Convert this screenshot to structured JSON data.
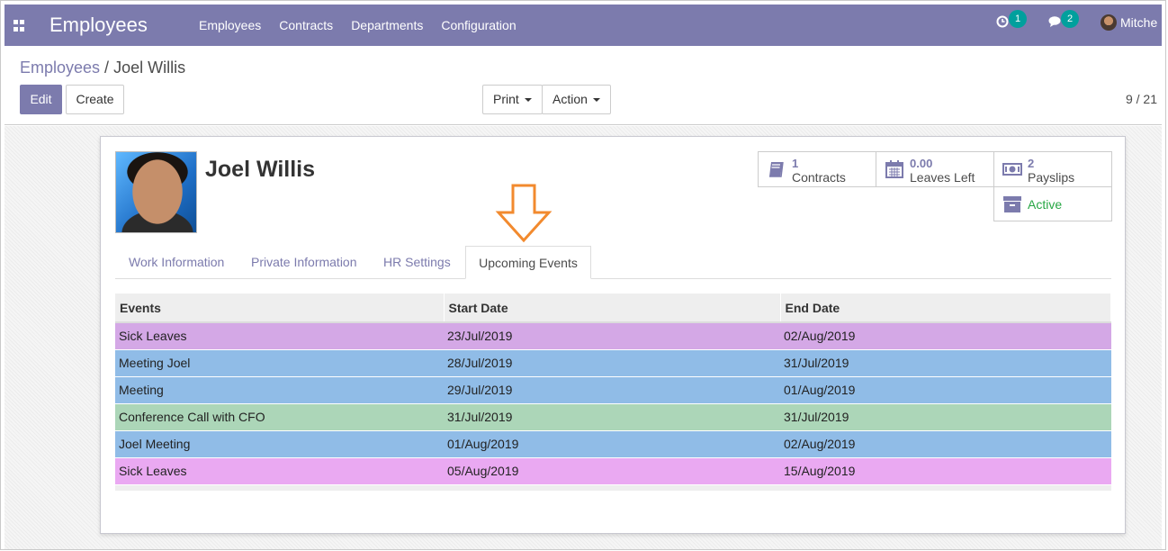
{
  "navbar": {
    "app_title": "Employees",
    "menu": [
      "Employees",
      "Contracts",
      "Departments",
      "Configuration"
    ],
    "activity_count": "1",
    "messages_count": "2",
    "user_name": "Mitche"
  },
  "breadcrumb": {
    "parent": "Employees",
    "separator": "/",
    "current": "Joel Willis"
  },
  "toolbar": {
    "edit_label": "Edit",
    "create_label": "Create",
    "print_label": "Print",
    "action_label": "Action",
    "pager": "9 / 21"
  },
  "employee": {
    "name": "Joel Willis"
  },
  "stats": {
    "contracts": {
      "value": "1",
      "label": "Contracts"
    },
    "leaves": {
      "value": "0.00",
      "label": "Leaves Left"
    },
    "payslips": {
      "value": "2",
      "label": "Payslips"
    },
    "status": {
      "label": "Active"
    }
  },
  "tabs": [
    "Work Information",
    "Private Information",
    "HR Settings",
    "Upcoming Events"
  ],
  "active_tab": "Upcoming Events",
  "events_table": {
    "headers": [
      "Events",
      "Start Date",
      "End Date"
    ],
    "rows": [
      {
        "event": "Sick Leaves",
        "start": "23/Jul/2019",
        "end": "02/Aug/2019",
        "color": "#d4a8e6"
      },
      {
        "event": "Meeting Joel",
        "start": "28/Jul/2019",
        "end": "31/Jul/2019",
        "color": "#90bce7"
      },
      {
        "event": "Meeting",
        "start": "29/Jul/2019",
        "end": "01/Aug/2019",
        "color": "#90bce7"
      },
      {
        "event": "Conference Call with CFO",
        "start": "31/Jul/2019",
        "end": "31/Jul/2019",
        "color": "#acd6b8"
      },
      {
        "event": "Joel Meeting",
        "start": "01/Aug/2019",
        "end": "02/Aug/2019",
        "color": "#90bce7"
      },
      {
        "event": "Sick Leaves",
        "start": "05/Aug/2019",
        "end": "15/Aug/2019",
        "color": "#eaa9f2"
      }
    ]
  },
  "colors": {
    "brand": "#7c7bad",
    "badge": "#00a09d",
    "arrow": "#f28a2e",
    "active": "#28a745"
  }
}
